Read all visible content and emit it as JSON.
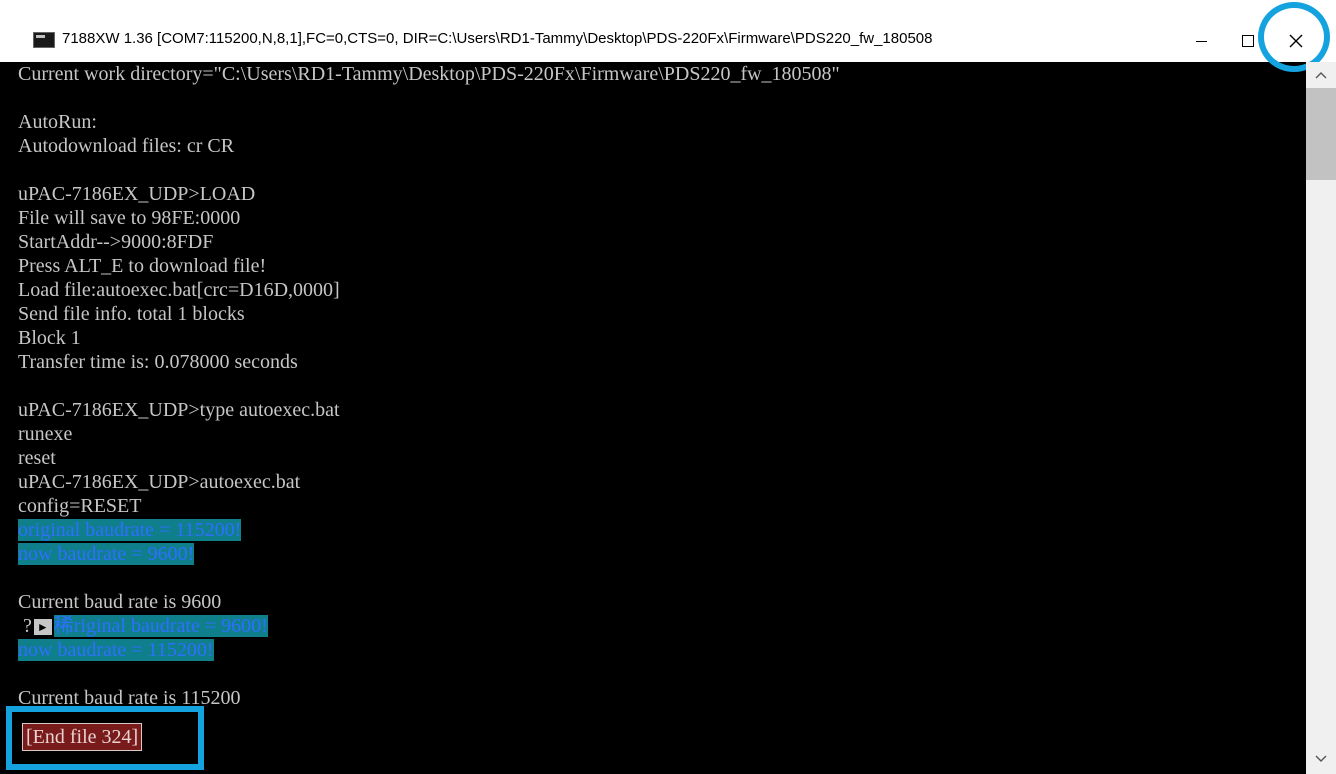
{
  "window": {
    "title": "7188XW 1.36 [COM7:115200,N,8,1],FC=0,CTS=0, DIR=C:\\Users\\RD1-Tammy\\Desktop\\PDS-220Fx\\Firmware\\PDS220_fw_180508",
    "icon": "console-app-icon",
    "controls": [
      "minimize-icon",
      "maximize-icon",
      "close-icon"
    ]
  },
  "console": {
    "lines": [
      "Current work directory=\"C:\\Users\\RD1-Tammy\\Desktop\\PDS-220Fx\\Firmware\\PDS220_fw_180508\"",
      "",
      "AutoRun:",
      "Autodownload files: cr CR",
      "",
      "uPAC-7186EX_UDP>LOAD",
      "File will save to 98FE:0000",
      "StartAddr-->9000:8FDF",
      "Press ALT_E to download file!",
      "Load file:autoexec.bat[crc=D16D,0000]",
      "Send file info. total 1 blocks",
      "Block 1",
      "Transfer time is: 0.078000 seconds",
      "",
      "uPAC-7186EX_UDP>type autoexec.bat",
      "runexe",
      "reset",
      "uPAC-7186EX_UDP>autoexec.bat",
      "config=RESET"
    ],
    "hl1": "original baudrate = 115200!",
    "hl2": "now baudrate = 9600!",
    "baud1": "Current baud rate is 9600",
    "garbled_prefix": " ?",
    "garbled_mark": "►",
    "hl3": "稀riginal baudrate = 9600!",
    "hl4": "now baudrate = 115200!",
    "baud2": "Current baud rate is 115200",
    "end_file": "[End file 324]"
  },
  "colors": {
    "highlight_bg": "#0f7f8c",
    "highlight_text": "#2e6fff",
    "annotation": "#14a3df",
    "end_file_bg": "#7a1b1b"
  }
}
